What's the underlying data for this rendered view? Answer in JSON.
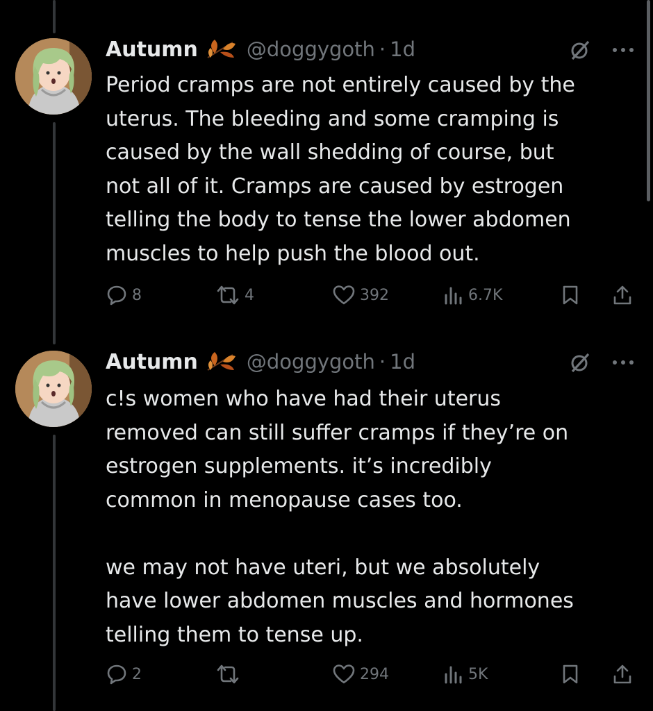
{
  "tweets": [
    {
      "name": "Autumn",
      "handle": "@doggygoth",
      "separator": "·",
      "time": "1d",
      "text": "Period cramps are not entirely caused by the\nuterus. The bleeding and some cramping is\ncaused by the wall shedding of course, but\nnot all of it. Cramps are caused by estrogen\ntelling the body to tense the lower abdomen\nmuscles to help push the blood out.",
      "replies": "8",
      "reposts": "4",
      "likes": "392",
      "views": "6.7K"
    },
    {
      "name": "Autumn",
      "handle": "@doggygoth",
      "separator": "·",
      "time": "1d",
      "text": "c!s women who have had their uterus\nremoved can still suffer cramps if they’re on\nestrogen supplements. it’s incredibly\ncommon in menopause cases too.\n\nwe may not have uteri, but we absolutely\nhave lower abdomen muscles and hormones\ntelling them to tense up.",
      "replies": "2",
      "reposts": "",
      "likes": "294",
      "views": "5K"
    }
  ],
  "colors": {
    "background": "#000000",
    "text": "#e7e9ea",
    "muted": "#71767b",
    "thread_line": "#333639"
  }
}
